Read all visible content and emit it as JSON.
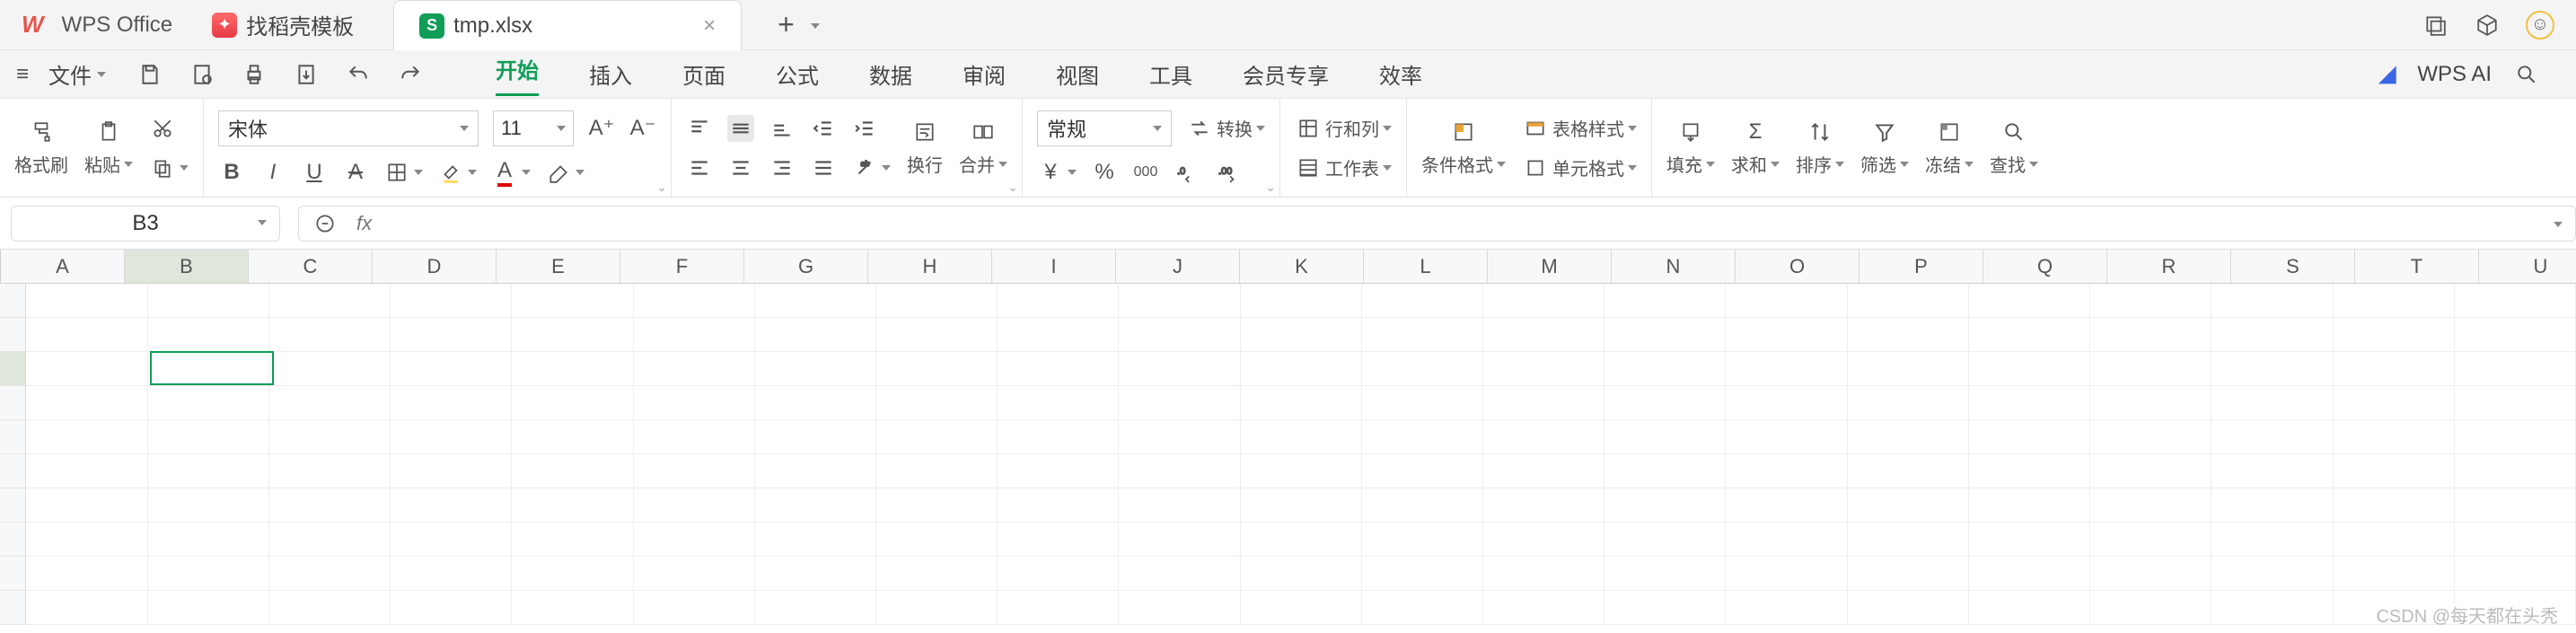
{
  "title_bar": {
    "app_name": "WPS Office",
    "tabs": [
      {
        "label": "找稻壳模板"
      },
      {
        "label": "tmp.xlsx"
      }
    ],
    "add": "+"
  },
  "menu_row": {
    "file": "文件",
    "menus": [
      "开始",
      "插入",
      "页面",
      "公式",
      "数据",
      "审阅",
      "视图",
      "工具",
      "会员专享",
      "效率"
    ],
    "ai": "WPS AI"
  },
  "ribbon": {
    "format_painter": "格式刷",
    "paste": "粘贴",
    "font_name": "宋体",
    "font_size": "11",
    "wrap": "换行",
    "merge": "合并",
    "num_format": "常规",
    "convert": "转换",
    "row_col": "行和列",
    "worksheet": "工作表",
    "cond_fmt": "条件格式",
    "table_style": "表格样式",
    "cell_fmt": "单元格式",
    "fill": "填充",
    "sum": "求和",
    "sort": "排序",
    "filter": "筛选",
    "freeze": "冻结",
    "find": "查找"
  },
  "formula_bar": {
    "name_box": "B3",
    "fx": "fx"
  },
  "columns": [
    "A",
    "B",
    "C",
    "D",
    "E",
    "F",
    "G",
    "H",
    "I",
    "J",
    "K",
    "L",
    "M",
    "N",
    "O",
    "P",
    "Q",
    "R",
    "S",
    "T",
    "U"
  ],
  "active_cell": {
    "col_index": 1,
    "row_index": 2
  },
  "watermark": "CSDN @每天都在头秃"
}
